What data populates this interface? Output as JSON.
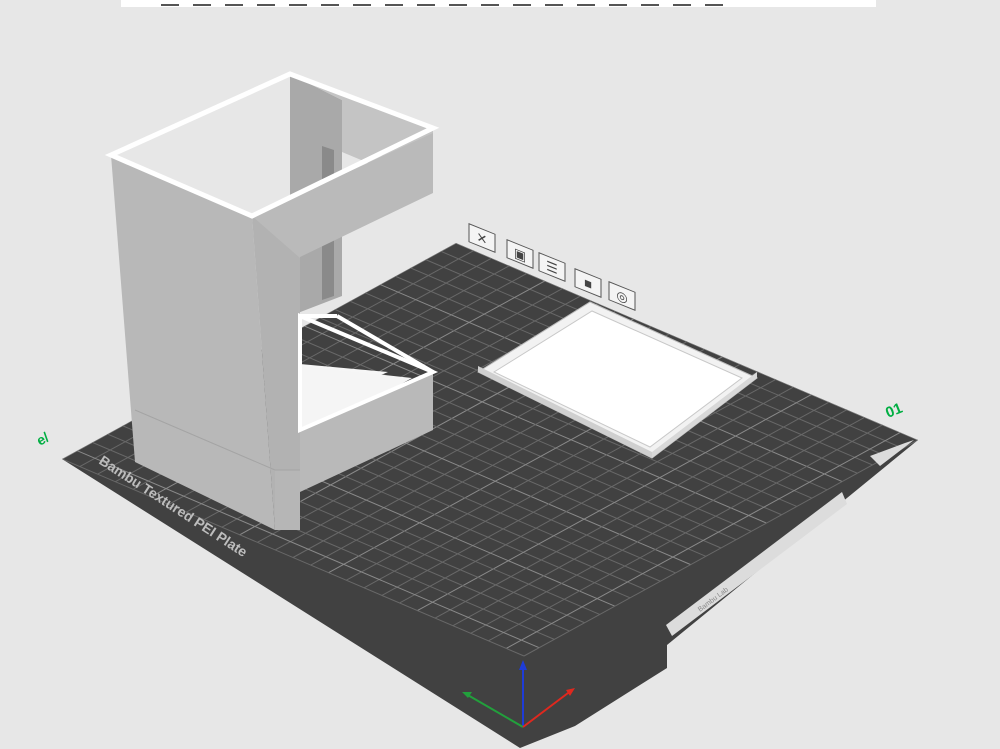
{
  "toolbar": {
    "buttons": [
      "add-icon",
      "add-plate-icon",
      "orient-icon",
      "arrange-icon",
      "split-icon",
      "slice-plane-icon",
      "move-icon",
      "rotate-icon",
      "scale-icon",
      "lay-on-face-icon",
      "cut-icon",
      "support-paint-icon",
      "seam-paint-icon",
      "color-paint-icon",
      "measure-icon",
      "assembly-icon",
      "text-icon",
      "view-icon"
    ]
  },
  "plate": {
    "name": "Bambu Textured PEI Plate",
    "number": "01",
    "label_text": "Bambu Lab"
  },
  "plate_tools": [
    "delete-plate-icon",
    "arrange-plate-icon",
    "orient-plate-icon",
    "lock-plate-icon",
    "plate-settings-icon"
  ],
  "colors": {
    "bed": "#414141",
    "grid": "#6b6b6b",
    "model": "#b4b4b4",
    "accent": "#00ae42",
    "axis_x": "#e0281e",
    "axis_y": "#22a03c",
    "axis_z": "#1e3cd8"
  }
}
